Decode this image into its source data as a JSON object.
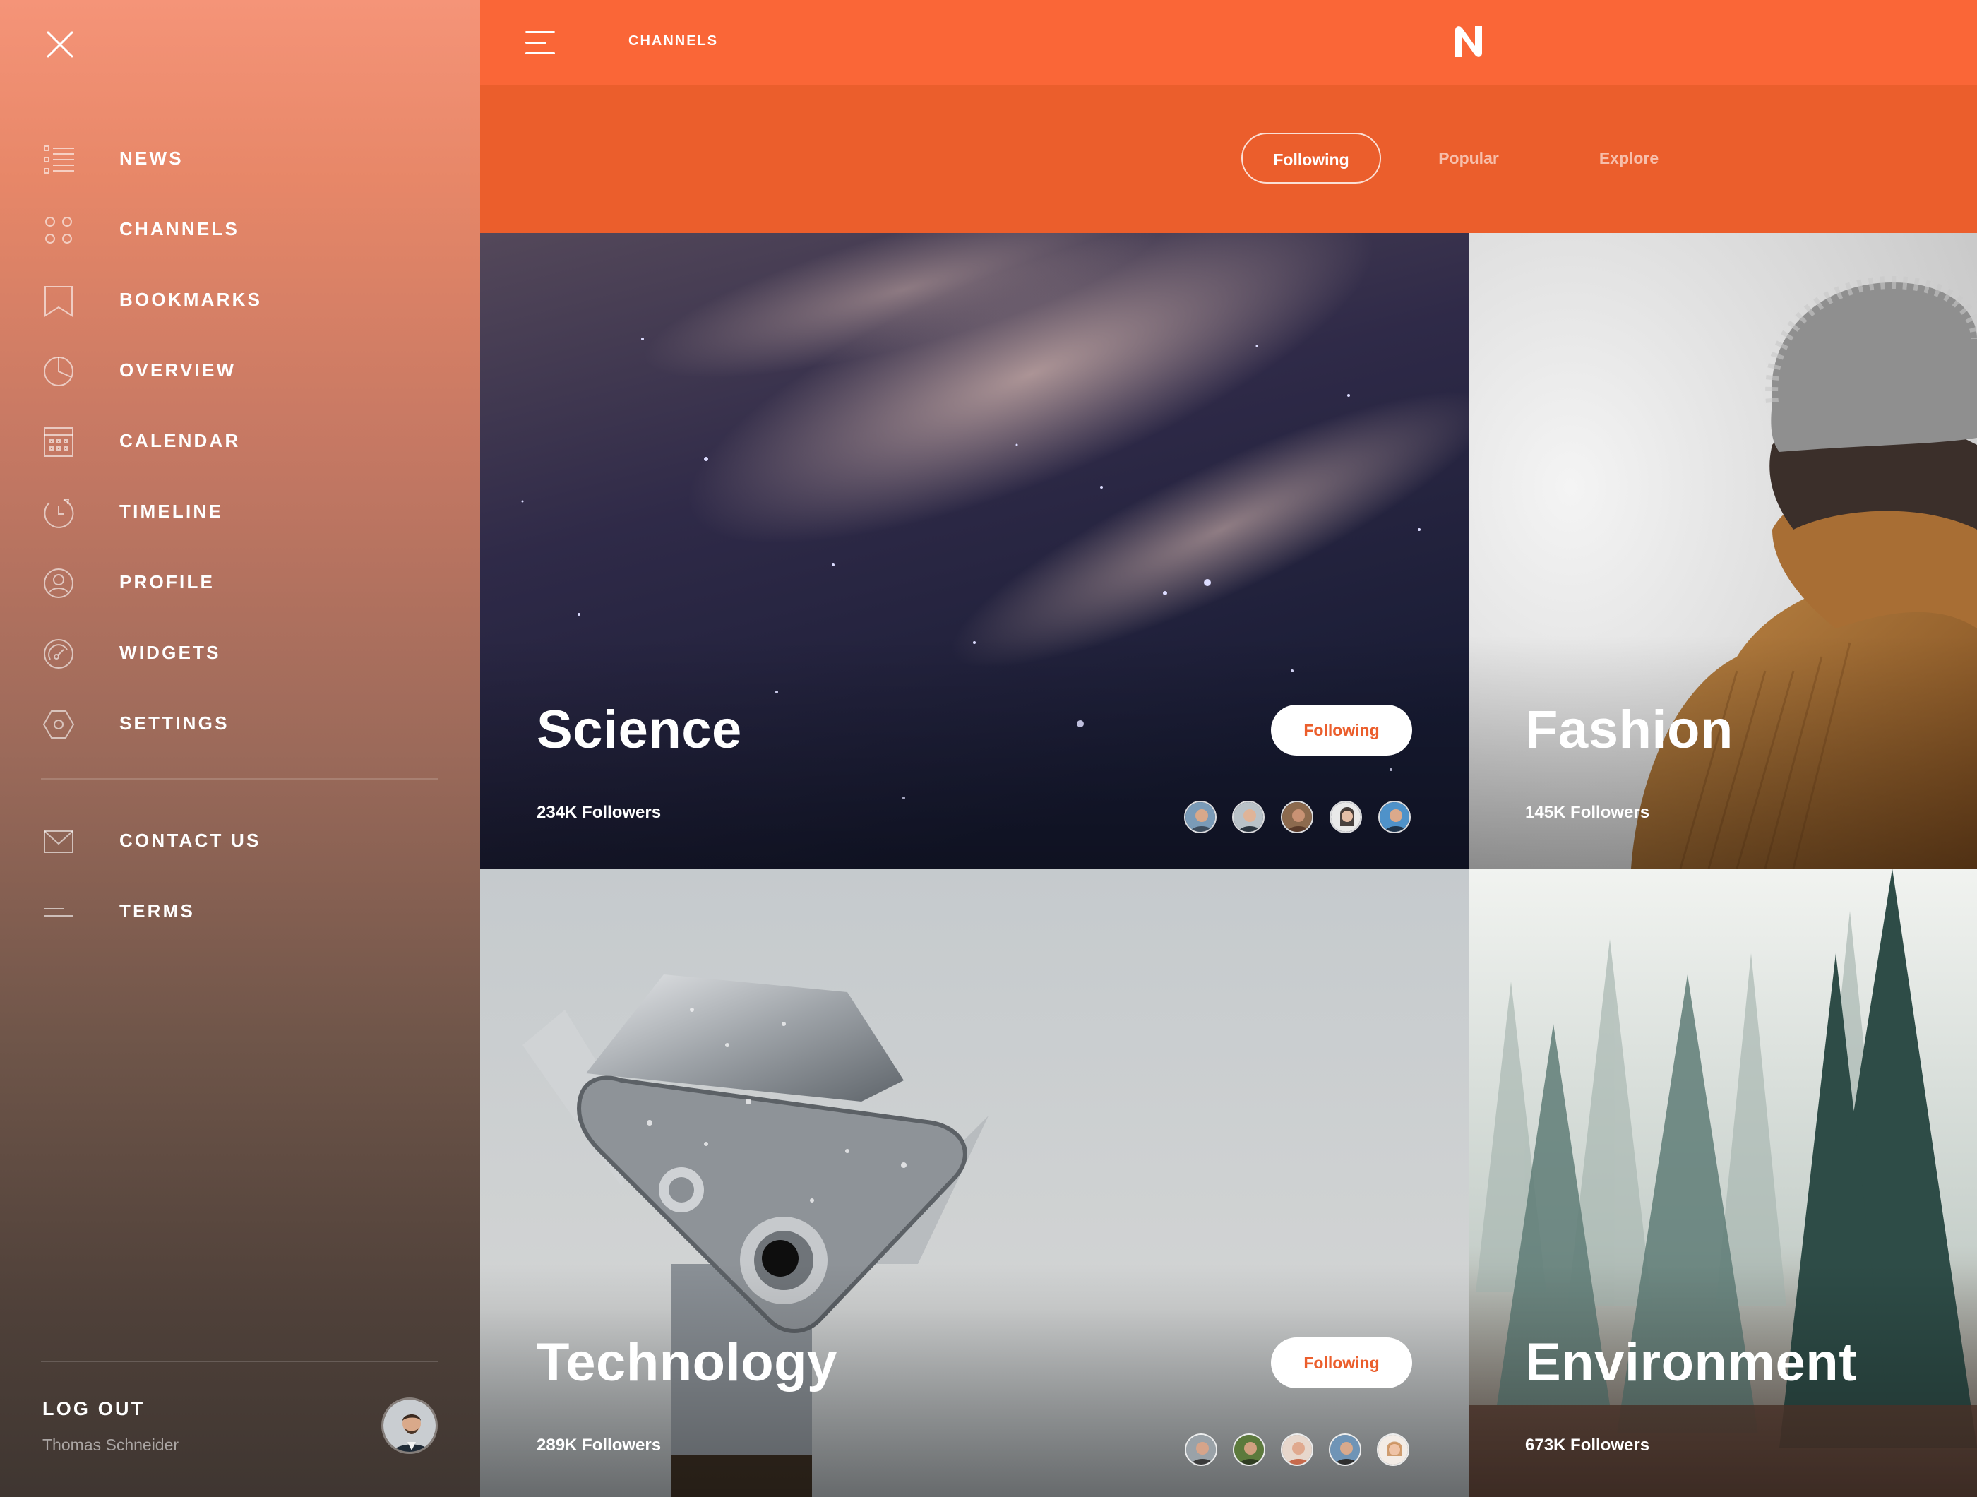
{
  "sidebar": {
    "items": [
      {
        "label": "NEWS",
        "icon": "list-icon"
      },
      {
        "label": "CHANNELS",
        "icon": "grid-dots-icon"
      },
      {
        "label": "BOOKMARKS",
        "icon": "bookmark-icon"
      },
      {
        "label": "OVERVIEW",
        "icon": "pie-chart-icon"
      },
      {
        "label": "CALENDAR",
        "icon": "calendar-icon"
      },
      {
        "label": "TIMELINE",
        "icon": "history-icon"
      },
      {
        "label": "PROFILE",
        "icon": "user-circle-icon"
      },
      {
        "label": "WIDGETS",
        "icon": "gauge-icon"
      },
      {
        "label": "SETTINGS",
        "icon": "hexagon-settings-icon"
      }
    ],
    "secondary": [
      {
        "label": "CONTACT US",
        "icon": "mail-icon"
      },
      {
        "label": "TERMS",
        "icon": "lines-icon"
      }
    ],
    "logout_label": "LOG OUT",
    "user_name": "Thomas Schneider"
  },
  "header": {
    "title": "CHANNELS",
    "logo_letter": "N"
  },
  "tabs": [
    {
      "label": "Following",
      "active": true
    },
    {
      "label": "Popular",
      "active": false
    },
    {
      "label": "Explore",
      "active": false
    }
  ],
  "channels": [
    {
      "name": "Science",
      "followers": "234K Followers",
      "button": "Following"
    },
    {
      "name": "Fashion",
      "followers": "145K Followers"
    },
    {
      "name": "Technology",
      "followers": "289K Followers",
      "button": "Following"
    },
    {
      "name": "Environment",
      "followers": "673K Followers"
    }
  ],
  "colors": {
    "accent": "#fa6637",
    "accent_dark": "#eb5e2c"
  }
}
